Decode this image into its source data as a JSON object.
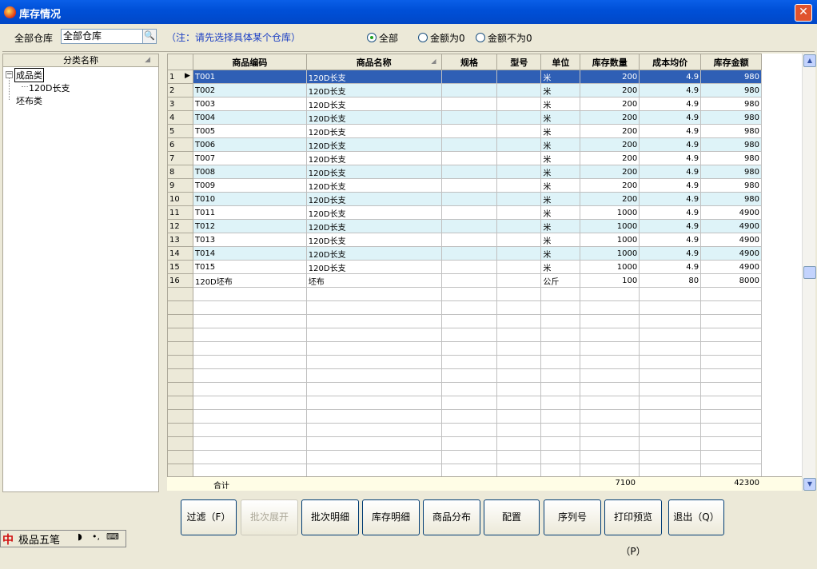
{
  "window": {
    "title": "库存情况",
    "close": "✕"
  },
  "toolbar": {
    "warehouse_label": "全部仓库",
    "warehouse_value": "全部仓库",
    "note": "（注：请先选择具体某个仓库）",
    "radios": [
      {
        "label": "全部",
        "checked": true
      },
      {
        "label": "金额为0",
        "checked": false
      },
      {
        "label": "金额不为0",
        "checked": false
      }
    ]
  },
  "tree": {
    "header": "分类名称",
    "nodes": [
      {
        "label": "成品类",
        "selected": true
      },
      {
        "label": "120D长支"
      },
      {
        "label": "坯布类"
      }
    ]
  },
  "grid": {
    "columns": [
      "商品编码",
      "商品名称",
      "规格",
      "型号",
      "单位",
      "库存数量",
      "成本均价",
      "库存金额"
    ],
    "rows": [
      [
        "1",
        "T001",
        "120D长支",
        "",
        "",
        "米",
        "200",
        "4.9",
        "980"
      ],
      [
        "2",
        "T002",
        "120D长支",
        "",
        "",
        "米",
        "200",
        "4.9",
        "980"
      ],
      [
        "3",
        "T003",
        "120D长支",
        "",
        "",
        "米",
        "200",
        "4.9",
        "980"
      ],
      [
        "4",
        "T004",
        "120D长支",
        "",
        "",
        "米",
        "200",
        "4.9",
        "980"
      ],
      [
        "5",
        "T005",
        "120D长支",
        "",
        "",
        "米",
        "200",
        "4.9",
        "980"
      ],
      [
        "6",
        "T006",
        "120D长支",
        "",
        "",
        "米",
        "200",
        "4.9",
        "980"
      ],
      [
        "7",
        "T007",
        "120D长支",
        "",
        "",
        "米",
        "200",
        "4.9",
        "980"
      ],
      [
        "8",
        "T008",
        "120D长支",
        "",
        "",
        "米",
        "200",
        "4.9",
        "980"
      ],
      [
        "9",
        "T009",
        "120D长支",
        "",
        "",
        "米",
        "200",
        "4.9",
        "980"
      ],
      [
        "10",
        "T010",
        "120D长支",
        "",
        "",
        "米",
        "200",
        "4.9",
        "980"
      ],
      [
        "11",
        "T011",
        "120D长支",
        "",
        "",
        "米",
        "1000",
        "4.9",
        "4900"
      ],
      [
        "12",
        "T012",
        "120D长支",
        "",
        "",
        "米",
        "1000",
        "4.9",
        "4900"
      ],
      [
        "13",
        "T013",
        "120D长支",
        "",
        "",
        "米",
        "1000",
        "4.9",
        "4900"
      ],
      [
        "14",
        "T014",
        "120D长支",
        "",
        "",
        "米",
        "1000",
        "4.9",
        "4900"
      ],
      [
        "15",
        "T015",
        "120D长支",
        "",
        "",
        "米",
        "1000",
        "4.9",
        "4900"
      ],
      [
        "16",
        "120D坯布",
        "坯布",
        "",
        "",
        "公斤",
        "100",
        "80",
        "8000"
      ]
    ],
    "footer": {
      "label": "合计",
      "qty_total": "7100",
      "amount_total": "42300"
    }
  },
  "buttons": [
    {
      "label": "过滤（F）",
      "enabled": true
    },
    {
      "label": "批次展开",
      "enabled": false
    },
    {
      "label": "批次明细",
      "enabled": true
    },
    {
      "label": "库存明细",
      "enabled": true
    },
    {
      "label": "商品分布",
      "enabled": true
    },
    {
      "label": "配置",
      "enabled": true
    },
    {
      "label": "序列号",
      "enabled": true
    },
    {
      "label": "打印预览（P）",
      "enabled": true
    },
    {
      "label": "退出（Q）",
      "enabled": true
    }
  ],
  "ime": {
    "logo": "中",
    "name": "极品五笔"
  },
  "colors": {
    "title_bar": "#0050d8",
    "selected_row": "#2f5fb5",
    "alt_row": "#def3f8",
    "note": "#1b3fc4",
    "footer_bg": "#fffde6"
  }
}
